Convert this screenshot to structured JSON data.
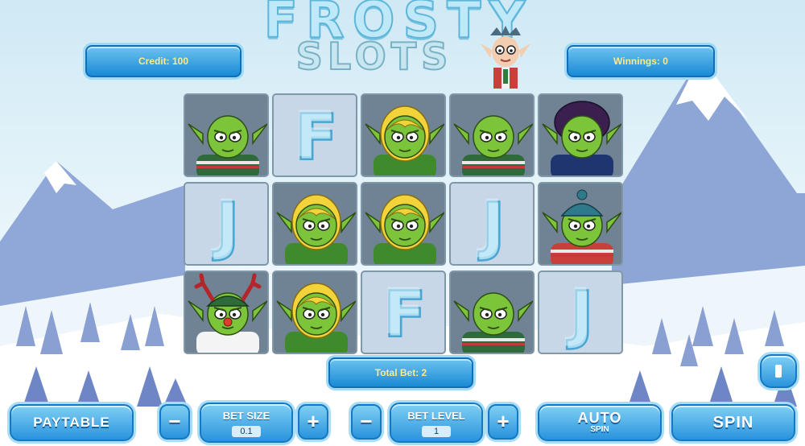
{
  "game": {
    "title_line1": "FROSTY",
    "title_line2": "SLOTS"
  },
  "hud": {
    "credit": "Credit: 100",
    "winnings": "Winnings: 0",
    "total_bet": "Total Bet: 2"
  },
  "reels": [
    [
      "goblin-boy-sweater",
      "ice-letter-F",
      "goblin-girl-blonde",
      "goblin-boy-sweater",
      "goblin-purple-hair"
    ],
    [
      "ice-letter-J",
      "goblin-girl-blonde",
      "goblin-girl-blonde",
      "ice-letter-J",
      "goblin-beanie"
    ],
    [
      "goblin-reindeer",
      "goblin-girl-blonde",
      "ice-letter-F",
      "goblin-boy-sweater",
      "ice-letter-J"
    ]
  ],
  "letters": {
    "F": "F",
    "J": "J"
  },
  "controls": {
    "paytable": "PAYTABLE",
    "minus": "−",
    "plus": "+",
    "bet_size_label": "BET SIZE",
    "bet_size_value": "0.1",
    "bet_level_label": "BET LEVEL",
    "bet_level_value": "1",
    "auto_label": "AUTO",
    "auto_sub": "SPIN",
    "spin": "SPIN"
  },
  "colors": {
    "panel": "#1a8ad6",
    "accent_text": "#ffe98a",
    "goblin_skin": "#7cc43a"
  }
}
